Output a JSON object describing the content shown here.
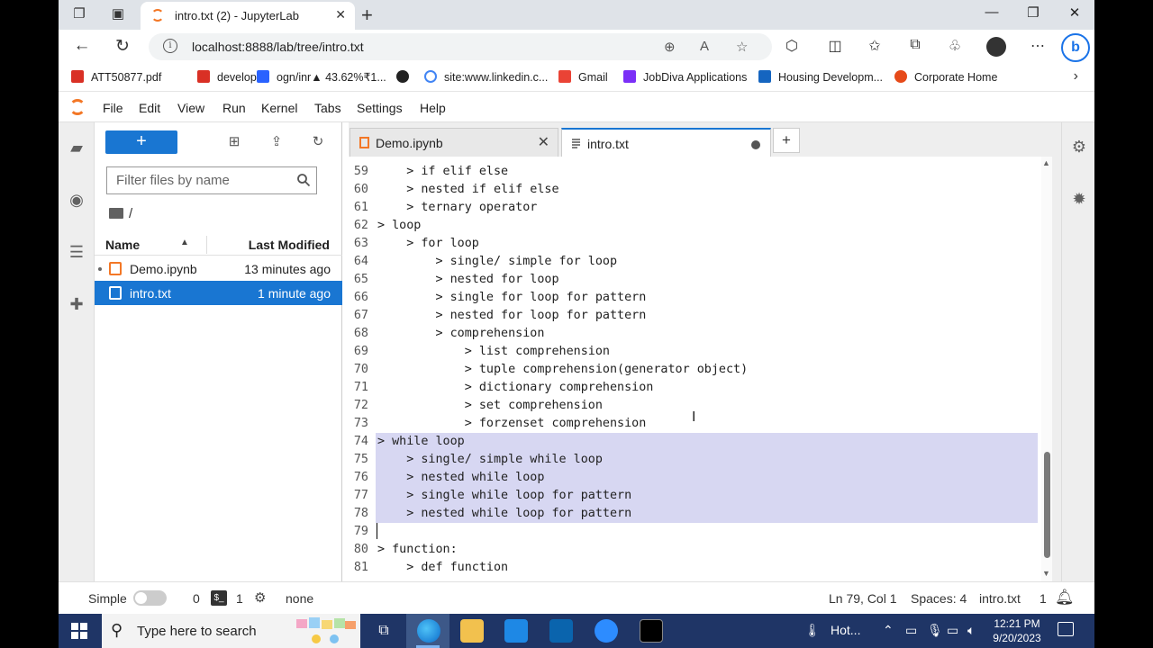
{
  "browser": {
    "tab_title": "intro.txt (2) - JupyterLab",
    "url": "localhost:8888/lab/tree/intro.txt",
    "bookmarks": [
      {
        "label": "ATT50877.pdf",
        "color": "#d93025"
      },
      {
        "label": "developer",
        "color": "#d93025"
      },
      {
        "label": "ogn/inr▲ 43.62%₹1...",
        "color": "#2962ff"
      },
      {
        "label": "",
        "color": "#222222"
      },
      {
        "label": "site:www.linkedin.c...",
        "color": "#4285f4"
      },
      {
        "label": "Gmail",
        "color": "#ea4335"
      },
      {
        "label": "JobDiva Applications",
        "color": "#7b2ff7"
      },
      {
        "label": "Housing Developm...",
        "color": "#1565c0"
      },
      {
        "label": "Corporate Home",
        "color": "#e64a19"
      }
    ]
  },
  "jupyter": {
    "menu": [
      "File",
      "Edit",
      "View",
      "Run",
      "Kernel",
      "Tabs",
      "Settings",
      "Help"
    ],
    "filebrowser": {
      "new_label": "+",
      "search_placeholder": "Filter files by name",
      "breadcrumb": "/",
      "col_name": "Name",
      "col_modified": "Last Modified",
      "files": [
        {
          "name": "Demo.ipynb",
          "modified": "13 minutes ago",
          "selected": false
        },
        {
          "name": "intro.txt",
          "modified": "1 minute ago",
          "selected": true
        }
      ]
    },
    "tabs": [
      {
        "label": "Demo.ipynb",
        "active": false
      },
      {
        "label": "intro.txt",
        "active": true,
        "dirty": true
      }
    ],
    "editor_lines": [
      {
        "n": "59",
        "text": "    > if elif else",
        "hl": false
      },
      {
        "n": "60",
        "text": "    > nested if elif else",
        "hl": false
      },
      {
        "n": "61",
        "text": "    > ternary operator",
        "hl": false
      },
      {
        "n": "62",
        "text": "> loop",
        "hl": false
      },
      {
        "n": "63",
        "text": "    > for loop",
        "hl": false
      },
      {
        "n": "64",
        "text": "        > single/ simple for loop",
        "hl": false
      },
      {
        "n": "65",
        "text": "        > nested for loop",
        "hl": false
      },
      {
        "n": "66",
        "text": "        > single for loop for pattern",
        "hl": false
      },
      {
        "n": "67",
        "text": "        > nested for loop for pattern",
        "hl": false
      },
      {
        "n": "68",
        "text": "        > comprehension",
        "hl": false
      },
      {
        "n": "69",
        "text": "            > list comprehension",
        "hl": false
      },
      {
        "n": "70",
        "text": "            > tuple comprehension(generator object)",
        "hl": false
      },
      {
        "n": "71",
        "text": "            > dictionary comprehension",
        "hl": false
      },
      {
        "n": "72",
        "text": "            > set comprehension",
        "hl": false
      },
      {
        "n": "73",
        "text": "            > forzenset comprehension",
        "hl": false
      },
      {
        "n": "74",
        "text": "> while loop",
        "hl": true
      },
      {
        "n": "75",
        "text": "    > single/ simple while loop",
        "hl": true
      },
      {
        "n": "76",
        "text": "    > nested while loop",
        "hl": true
      },
      {
        "n": "77",
        "text": "    > single while loop for pattern",
        "hl": true
      },
      {
        "n": "78",
        "text": "    > nested while loop for pattern",
        "hl": true
      },
      {
        "n": "79",
        "text": "",
        "hl": false
      },
      {
        "n": "80",
        "text": "> function:",
        "hl": false
      },
      {
        "n": "81",
        "text": "    > def function",
        "hl": false
      }
    ],
    "status": {
      "mode": "Simple",
      "terminals": "0",
      "kernels": "1",
      "kernel_name": "none",
      "position": "Ln 79, Col 1",
      "spaces": "Spaces: 4",
      "file": "intro.txt",
      "count": "1"
    }
  },
  "taskbar": {
    "search_placeholder": "Type here to search",
    "weather": "Hot...",
    "time": "12:21 PM",
    "date": "9/20/2023"
  }
}
